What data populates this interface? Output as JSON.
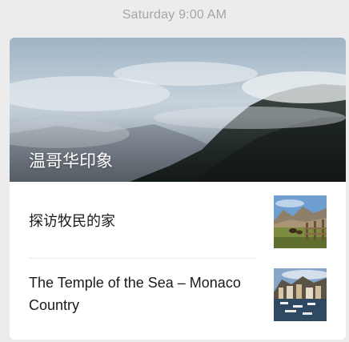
{
  "chat": {
    "timestamp": "Saturday 9:00 AM"
  },
  "news_card": {
    "cover_title": "温哥华印象",
    "articles": [
      {
        "title": "探访牧民的家",
        "thumb_icon": "ranch-horses-photo"
      },
      {
        "title": "The Temple of the Sea – Monaco Country",
        "thumb_icon": "monaco-harbor-photo"
      }
    ],
    "cover_icon": "mountain-forest-clouds-photo"
  }
}
